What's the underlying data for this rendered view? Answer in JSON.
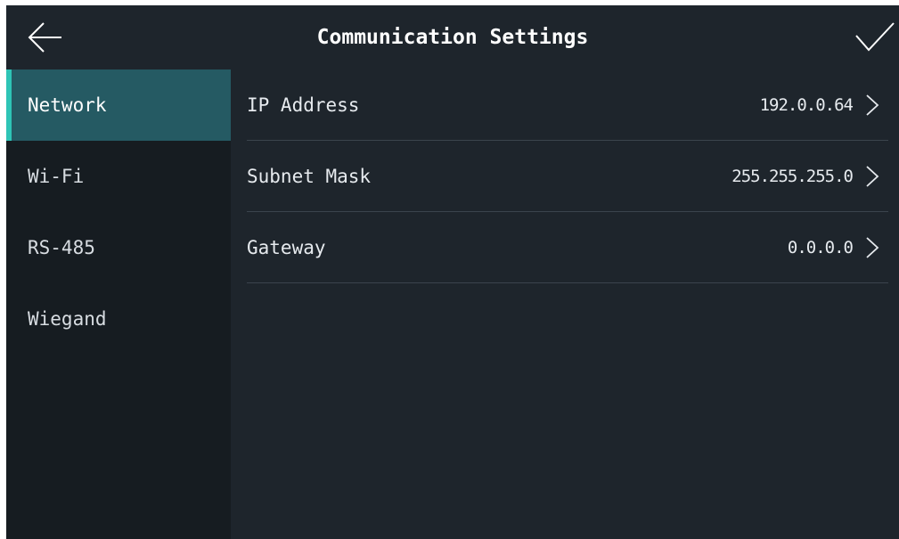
{
  "header": {
    "title": "Communication Settings",
    "back_icon": "arrow-left-icon",
    "confirm_icon": "checkmark-icon"
  },
  "sidebar": {
    "items": [
      {
        "label": "Network",
        "active": true
      },
      {
        "label": "Wi-Fi",
        "active": false
      },
      {
        "label": "RS-485",
        "active": false
      },
      {
        "label": "Wiegand",
        "active": false
      }
    ]
  },
  "network": {
    "rows": [
      {
        "label": "IP Address",
        "value": "192.0.0.64"
      },
      {
        "label": "Subnet Mask",
        "value": "255.255.255.0"
      },
      {
        "label": "Gateway",
        "value": "0.0.0.0"
      }
    ]
  },
  "colors": {
    "background": "#1e252c",
    "sidebar_background": "#161c21",
    "active_item": "#255a63",
    "accent": "#2ec4b6",
    "divider": "#3b444d",
    "text": "#ffffff"
  }
}
